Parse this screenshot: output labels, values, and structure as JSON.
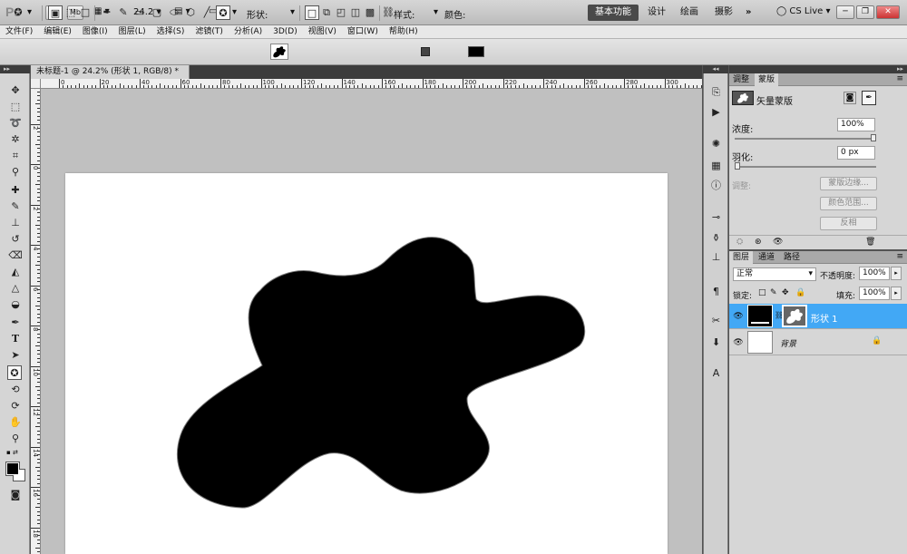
{
  "app": {
    "logo": "Ps",
    "bridge_label": "Br",
    "minibridge_label": "Mb",
    "zoom_value": "24.2",
    "workspaces": [
      "基本功能",
      "设计",
      "绘画",
      "摄影"
    ],
    "more_workspaces": "»",
    "cs_live": "CS Live",
    "window_controls": [
      "─",
      "❐",
      "✕"
    ]
  },
  "menu": [
    "文件(F)",
    "编辑(E)",
    "图像(I)",
    "图层(L)",
    "选择(S)",
    "滤镜(T)",
    "分析(A)",
    "3D(D)",
    "视图(V)",
    "窗口(W)",
    "帮助(H)"
  ],
  "options": {
    "shape_label": "形状:",
    "style_label": "样式:",
    "color_label": "颜色:",
    "color_value": "#000000"
  },
  "document": {
    "tab_title": "未标题-1 @ 24.2% (形状 1, RGB/8) *",
    "tab_close": "✕",
    "ruler_top": [
      "0",
      "20",
      "40",
      "60",
      "80",
      "100",
      "120",
      "140",
      "160",
      "180",
      "200",
      "220",
      "240",
      "260",
      "280",
      "300"
    ],
    "ruler_left": [
      "4",
      "2",
      "0",
      "2",
      "4",
      "6",
      "8",
      "10",
      "12",
      "14",
      "16",
      "18"
    ]
  },
  "masks_panel": {
    "tabs": [
      "调整",
      "蒙版"
    ],
    "active_tab": "蒙版",
    "mask_type": "矢量蒙版",
    "density_label": "浓度:",
    "density_value": "100%",
    "density_fraction": 1.0,
    "feather_label": "羽化:",
    "feather_value": "0 px",
    "feather_fraction": 0.0,
    "refine_label": "调整:",
    "mask_edge_button": "蒙版边缘...",
    "color_range_button": "颜色范围...",
    "invert_button": "反相"
  },
  "layers_panel": {
    "tabs": [
      "图层",
      "通道",
      "路径"
    ],
    "active_tab": "图层",
    "blend_mode": "正常",
    "opacity_label": "不透明度:",
    "opacity_value": "100%",
    "lock_label": "锁定:",
    "fill_label": "填充:",
    "fill_value": "100%",
    "layers": [
      {
        "name": "形状 1",
        "selected": true
      },
      {
        "name": "背景",
        "selected": false,
        "locked": true
      }
    ]
  },
  "colors": {
    "accent": "#42a8f5",
    "shape_fill": "#000000"
  }
}
